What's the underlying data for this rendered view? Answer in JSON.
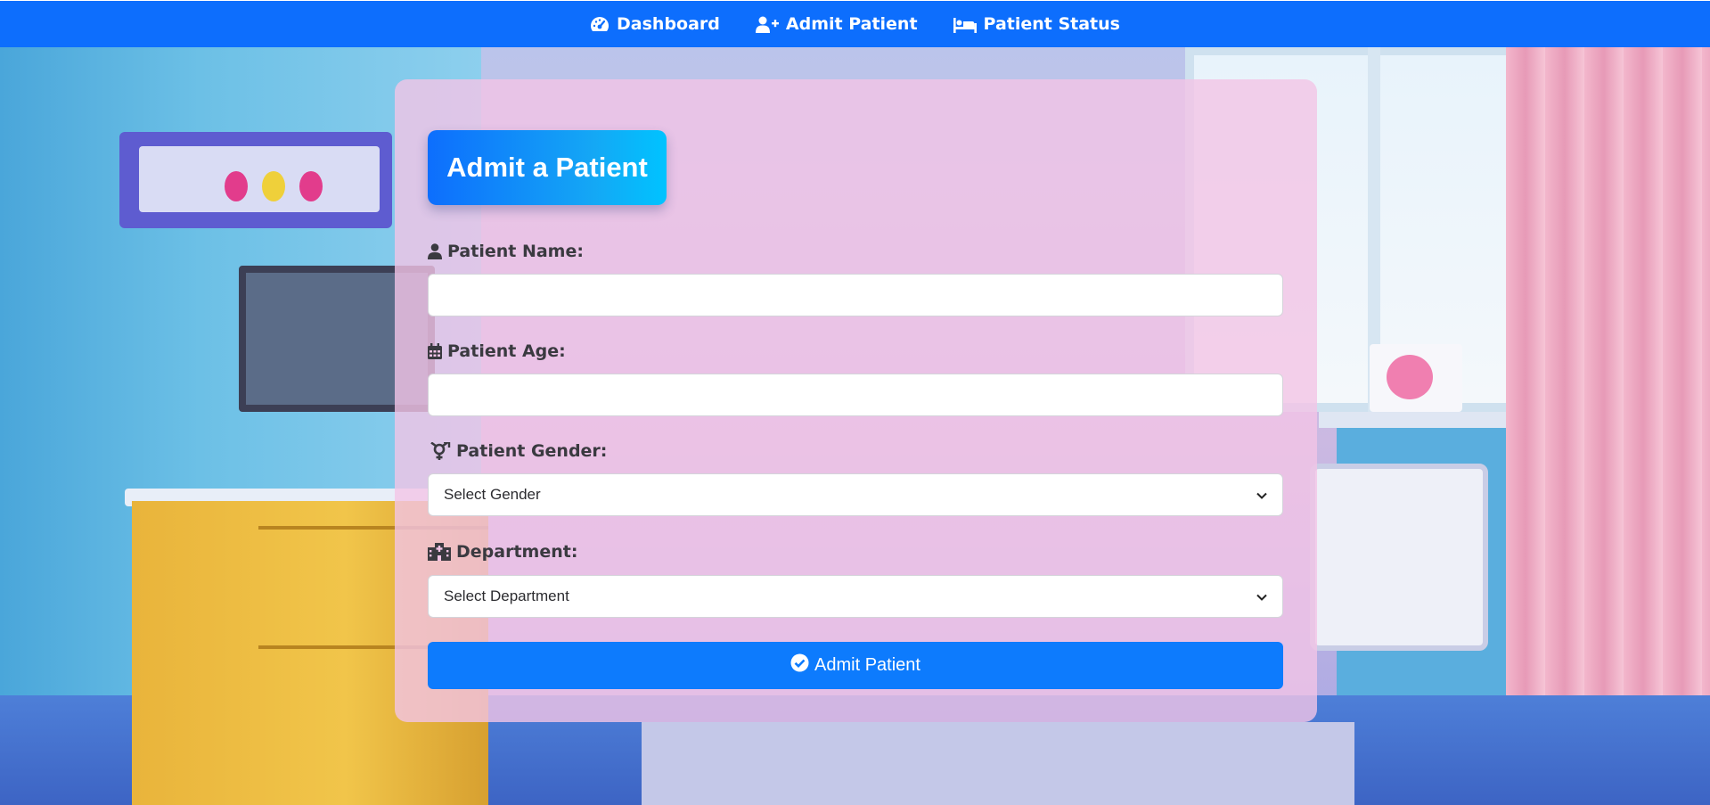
{
  "nav": {
    "items": [
      {
        "label": "Dashboard",
        "icon": "gauge-icon"
      },
      {
        "label": "Admit Patient",
        "icon": "user-plus-icon"
      },
      {
        "label": "Patient Status",
        "icon": "bed-icon"
      }
    ]
  },
  "form": {
    "title": "Admit a Patient",
    "fields": {
      "name": {
        "label": "Patient Name:",
        "value": "",
        "icon": "user-icon"
      },
      "age": {
        "label": "Patient Age:",
        "value": "",
        "icon": "calendar-icon"
      },
      "gender": {
        "label": "Patient Gender:",
        "selected": "Select Gender",
        "icon": "gender-icon"
      },
      "department": {
        "label": "Department:",
        "selected": "Select Department",
        "icon": "hospital-icon"
      }
    },
    "submit_label": "Admit Patient"
  },
  "colors": {
    "nav_bg": "#0d6efd",
    "button_bg": "#0d7bfd",
    "card_bg": "rgba(243,196,230,0.80)",
    "label_text": "#3a3a40"
  }
}
